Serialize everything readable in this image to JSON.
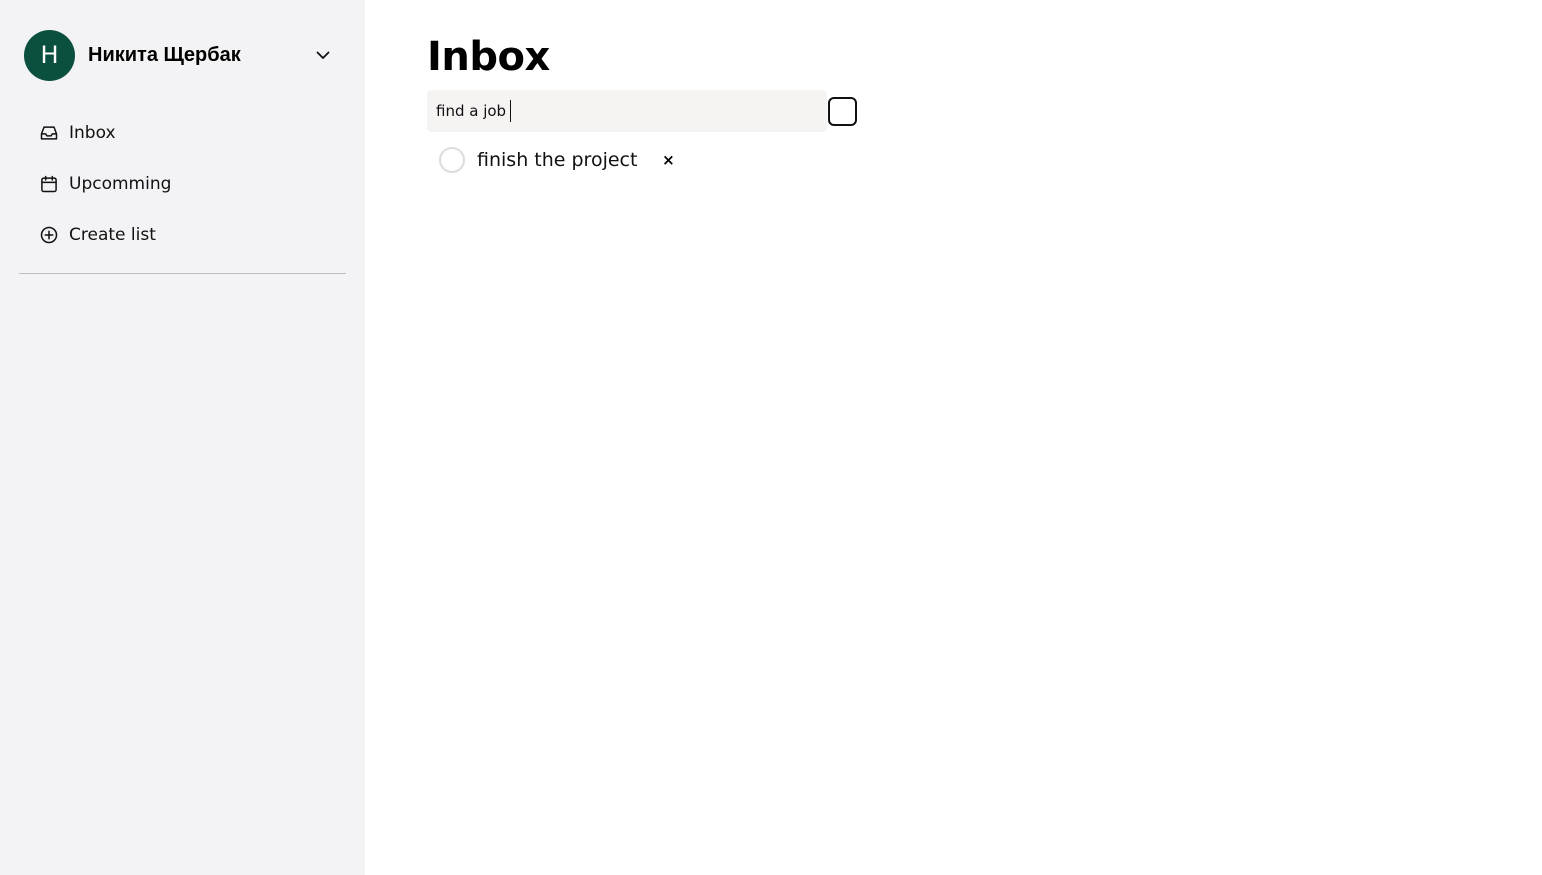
{
  "user": {
    "initial": "H",
    "name": "Никита Щербак",
    "avatar_color": "#0b4f3f"
  },
  "sidebar": {
    "items": [
      {
        "label": "Inbox",
        "icon": "inbox-icon"
      },
      {
        "label": "Upcomming",
        "icon": "calendar-icon"
      },
      {
        "label": "Create list",
        "icon": "plus-circle-icon"
      }
    ],
    "background": "#f3f3f5"
  },
  "main": {
    "title": "Inbox",
    "new_task_input": {
      "value": "find a job"
    },
    "tasks": [
      {
        "text": "finish the project",
        "remove_label": "×"
      }
    ]
  }
}
